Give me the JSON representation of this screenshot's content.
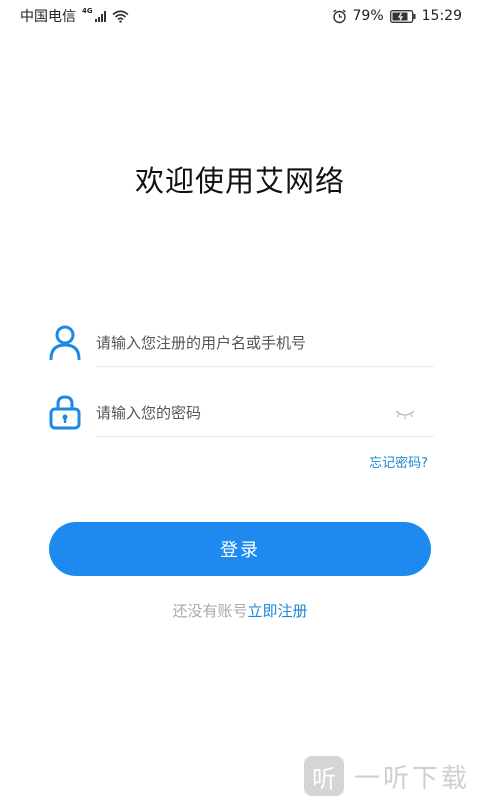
{
  "status_bar": {
    "carrier": "中国电信",
    "network": "4G",
    "battery": "79%",
    "time": "15:29",
    "icons": [
      "signal-icon",
      "wifi-icon",
      "alarm-icon",
      "battery-icon"
    ]
  },
  "title": "欢迎使用艾网络",
  "username": {
    "placeholder": "请输入您注册的用户名或手机号",
    "value": "",
    "icon": "user-icon"
  },
  "password": {
    "placeholder": "请输入您的密码",
    "value": "",
    "icon": "lock-icon",
    "toggle_icon": "eye-closed-icon"
  },
  "forgot_password": "忘记密码?",
  "login_button": "登录",
  "register": {
    "hint": "还没有账号",
    "link": "立即注册"
  },
  "watermark": {
    "logo_char": "听",
    "text": "一听下载"
  },
  "colors": {
    "accent": "#1e8af0",
    "link": "#1a88d4",
    "hint": "#aaaaaa",
    "icon": "#1e88e5"
  }
}
